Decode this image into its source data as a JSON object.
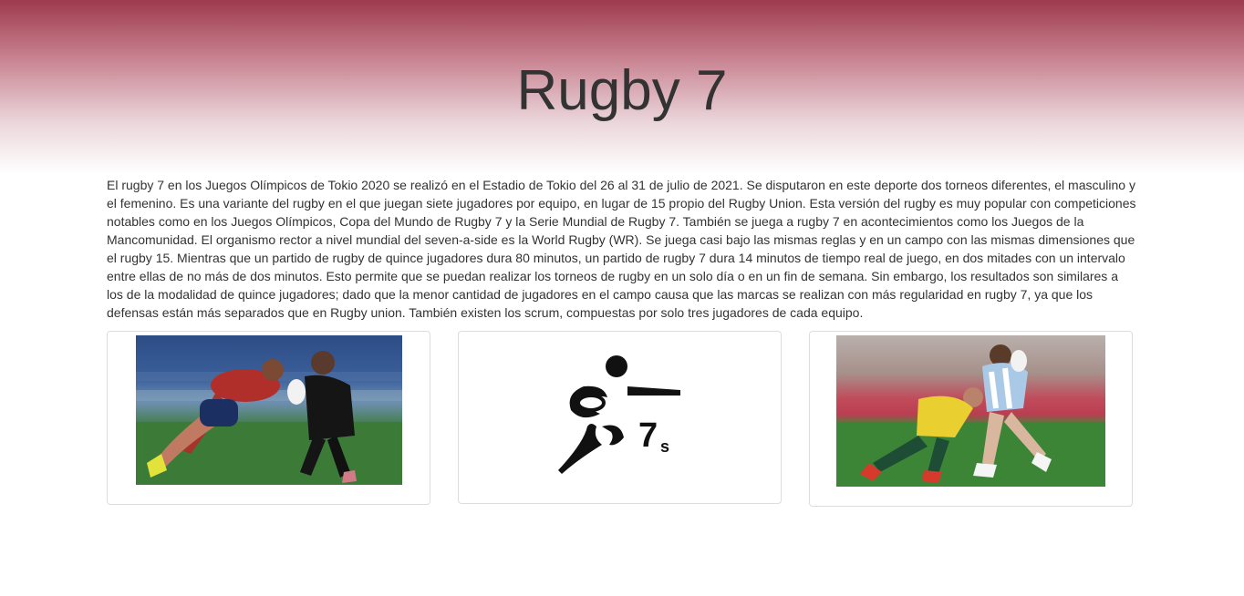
{
  "header": {
    "title": "Rugby 7"
  },
  "main": {
    "intro": "El rugby 7 en los Juegos Olímpicos de Tokio 2020 se realizó en el Estadio de Tokio del 26 al 31 de julio de 2021. Se disputaron en este deporte dos torneos diferentes, el masculino y el femenino. Es una variante del rugby en el que juegan siete jugadores por equipo, en lugar de 15 propio del Rugby Union. Esta versión del rugby es muy popular con competiciones notables como en los Juegos Olímpicos, Copa del Mundo de Rugby 7 y la Serie Mundial de Rugby 7. También se juega a rugby 7 en acontecimientos como los Juegos de la Mancomunidad. El organismo rector a nivel mundial del seven-a-side es la World Rugby (WR). Se juega casi bajo las mismas reglas y en un campo con las mismas dimensiones que el rugby 15. Mientras que un partido de rugby de quince jugadores dura 80 minutos, un partido de rugby 7 dura 14 minutos de tiempo real de juego, en dos mitades con un intervalo entre ellas de no más de dos minutos. Esto permite que se puedan realizar los torneos de rugby en un solo día o en un fin de semana. Sin embargo, los resultados son similares a los de la modalidad de quince jugadores; dado que la menor cantidad de jugadores en el campo causa que las marcas se realizan con más regularidad en rugby 7, ya que los defensas están más separados que en Rugby union. También existen los scrum, compuestas por solo tres jugadores de cada equipo."
  },
  "cards": [
    {
      "image": "women-rugby-match-photo"
    },
    {
      "image": "rugby-sevens-pictogram",
      "logo_text": "7",
      "logo_subscript": "s"
    },
    {
      "image": "men-rugby-tackle-photo"
    }
  ]
}
